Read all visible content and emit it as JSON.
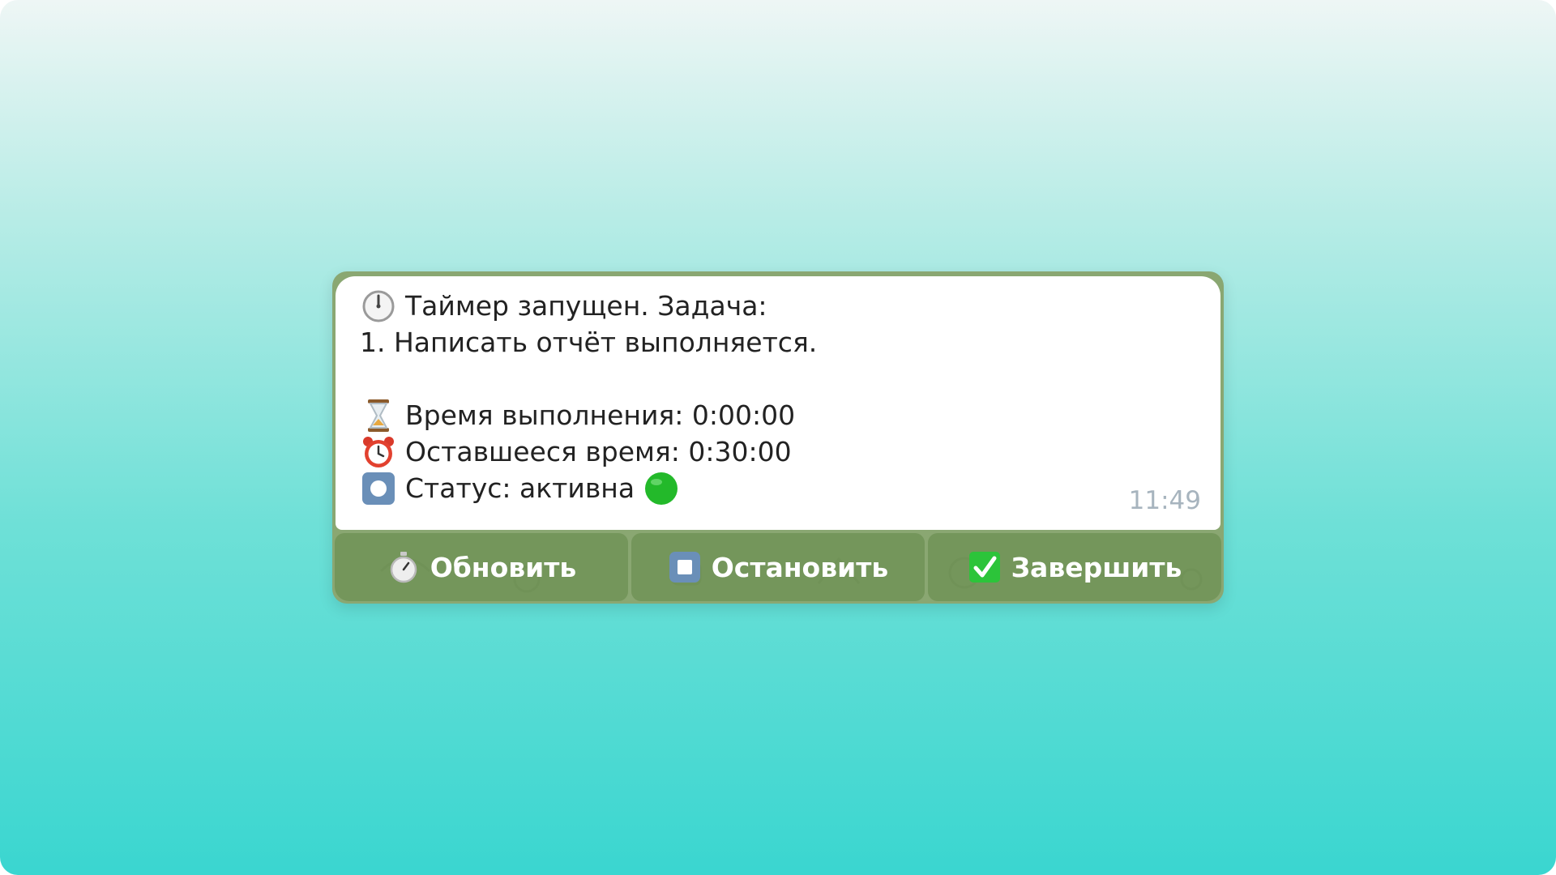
{
  "message": {
    "line1": "Таймер запущен. Задача:",
    "line2": "1. Написать отчёт выполняется.",
    "elapsed": "Время выполнения: 0:00:00",
    "remaining": "Оставшееся время: 0:30:00",
    "status": "Статус: активна",
    "time": "11:49",
    "icons": {
      "line1": "clock-icon",
      "elapsed": "hourglass-icon",
      "remaining": "alarm-clock-icon",
      "status": "record-button-icon",
      "status_indicator": "green-circle-icon"
    }
  },
  "buttons": [
    {
      "label": "Обновить",
      "icon": "stopwatch-icon"
    },
    {
      "label": "Остановить",
      "icon": "stop-button-icon"
    },
    {
      "label": "Завершить",
      "icon": "check-mark-button-icon"
    }
  ],
  "colors": {
    "chat_background": "#8aa772",
    "button_background": "#6e9155",
    "status_green": "#22c22e"
  }
}
